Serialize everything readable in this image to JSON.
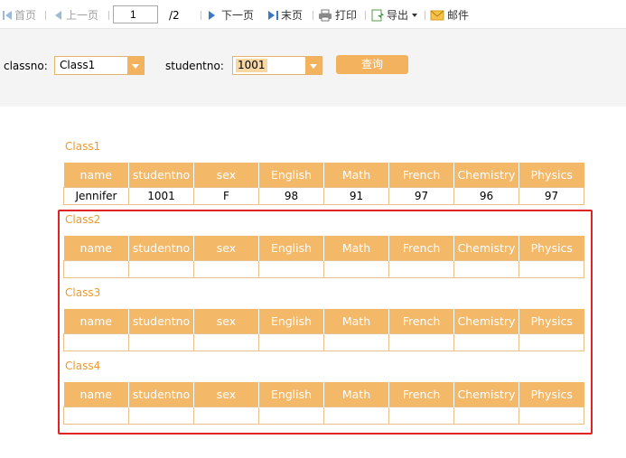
{
  "toolbar": {
    "first_label": "首页",
    "prev_label": "上一页",
    "current_page": "1",
    "total_pages": "/2",
    "next_label": "下一页",
    "last_label": "末页",
    "print_label": "打印",
    "export_label": "导出",
    "mail_label": "邮件"
  },
  "query": {
    "classno_label": "classno:",
    "classno_value": "Class1",
    "studentno_label": "studentno:",
    "studentno_value": "1001",
    "search_label": "查询"
  },
  "columns": [
    "name",
    "studentno",
    "sex",
    "English",
    "Math",
    "French",
    "Chemistry",
    "Physics"
  ],
  "classes": [
    {
      "title": "Class1",
      "rows": [
        [
          "Jennifer",
          "1001",
          "F",
          "98",
          "91",
          "97",
          "96",
          "97"
        ]
      ]
    },
    {
      "title": "Class2",
      "rows": [
        [
          "",
          "",
          "",
          "",
          "",
          "",
          "",
          ""
        ]
      ]
    },
    {
      "title": "Class3",
      "rows": [
        [
          "",
          "",
          "",
          "",
          "",
          "",
          "",
          ""
        ]
      ]
    },
    {
      "title": "Class4",
      "rows": [
        [
          "",
          "",
          "",
          "",
          "",
          "",
          "",
          ""
        ]
      ]
    }
  ],
  "colors": {
    "accent": "#f3b35e",
    "header_bg": "#f3b868",
    "title_text": "#ee9a2e",
    "highlight_border": "#e02424"
  },
  "icons": {
    "first": "first-page-icon",
    "prev": "prev-page-icon",
    "next": "next-page-icon",
    "last": "last-page-icon",
    "print": "printer-icon",
    "export": "export-icon",
    "mail": "mail-icon"
  }
}
